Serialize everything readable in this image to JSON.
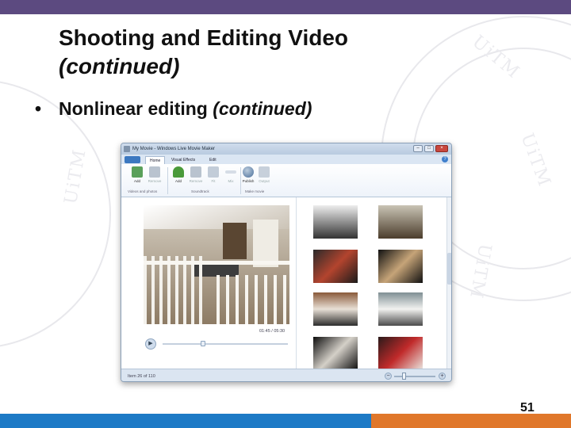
{
  "slide": {
    "title_line1": "Shooting and Editing Video",
    "title_line2": "(continued)",
    "bullet_main": "Nonlinear editing ",
    "bullet_italic": "(continued)",
    "page_number": "51",
    "colors": {
      "top_bar": "#5c4a80",
      "footer_blue": "#1d7ac6",
      "footer_orange": "#e0772a"
    }
  },
  "app": {
    "window_title": "My Movie - Windows Live Movie Maker",
    "tabs": [
      "Home",
      "Visual Effects",
      "Edit"
    ],
    "ribbon": {
      "buttons": [
        {
          "label": "Add",
          "icon": "add-video-icon"
        },
        {
          "label": "Remove",
          "icon": "remove-video-icon"
        },
        {
          "label": "Add",
          "icon": "add-music-icon"
        },
        {
          "label": "Remove",
          "icon": "remove-music-icon"
        },
        {
          "label": "Fit",
          "icon": "fit-icon"
        },
        {
          "label": "Mix",
          "icon": "mix-icon"
        },
        {
          "label": "Publish",
          "icon": "publish-globe-icon"
        },
        {
          "label": "Output",
          "icon": "output-icon"
        }
      ],
      "groups": [
        "Videos and photos",
        "Soundtrack",
        "Make movie"
      ]
    },
    "preview_time": "01:45 / 05:30",
    "status_text": "Item 26 of 110",
    "progress": {
      "playback": 0.32
    }
  }
}
